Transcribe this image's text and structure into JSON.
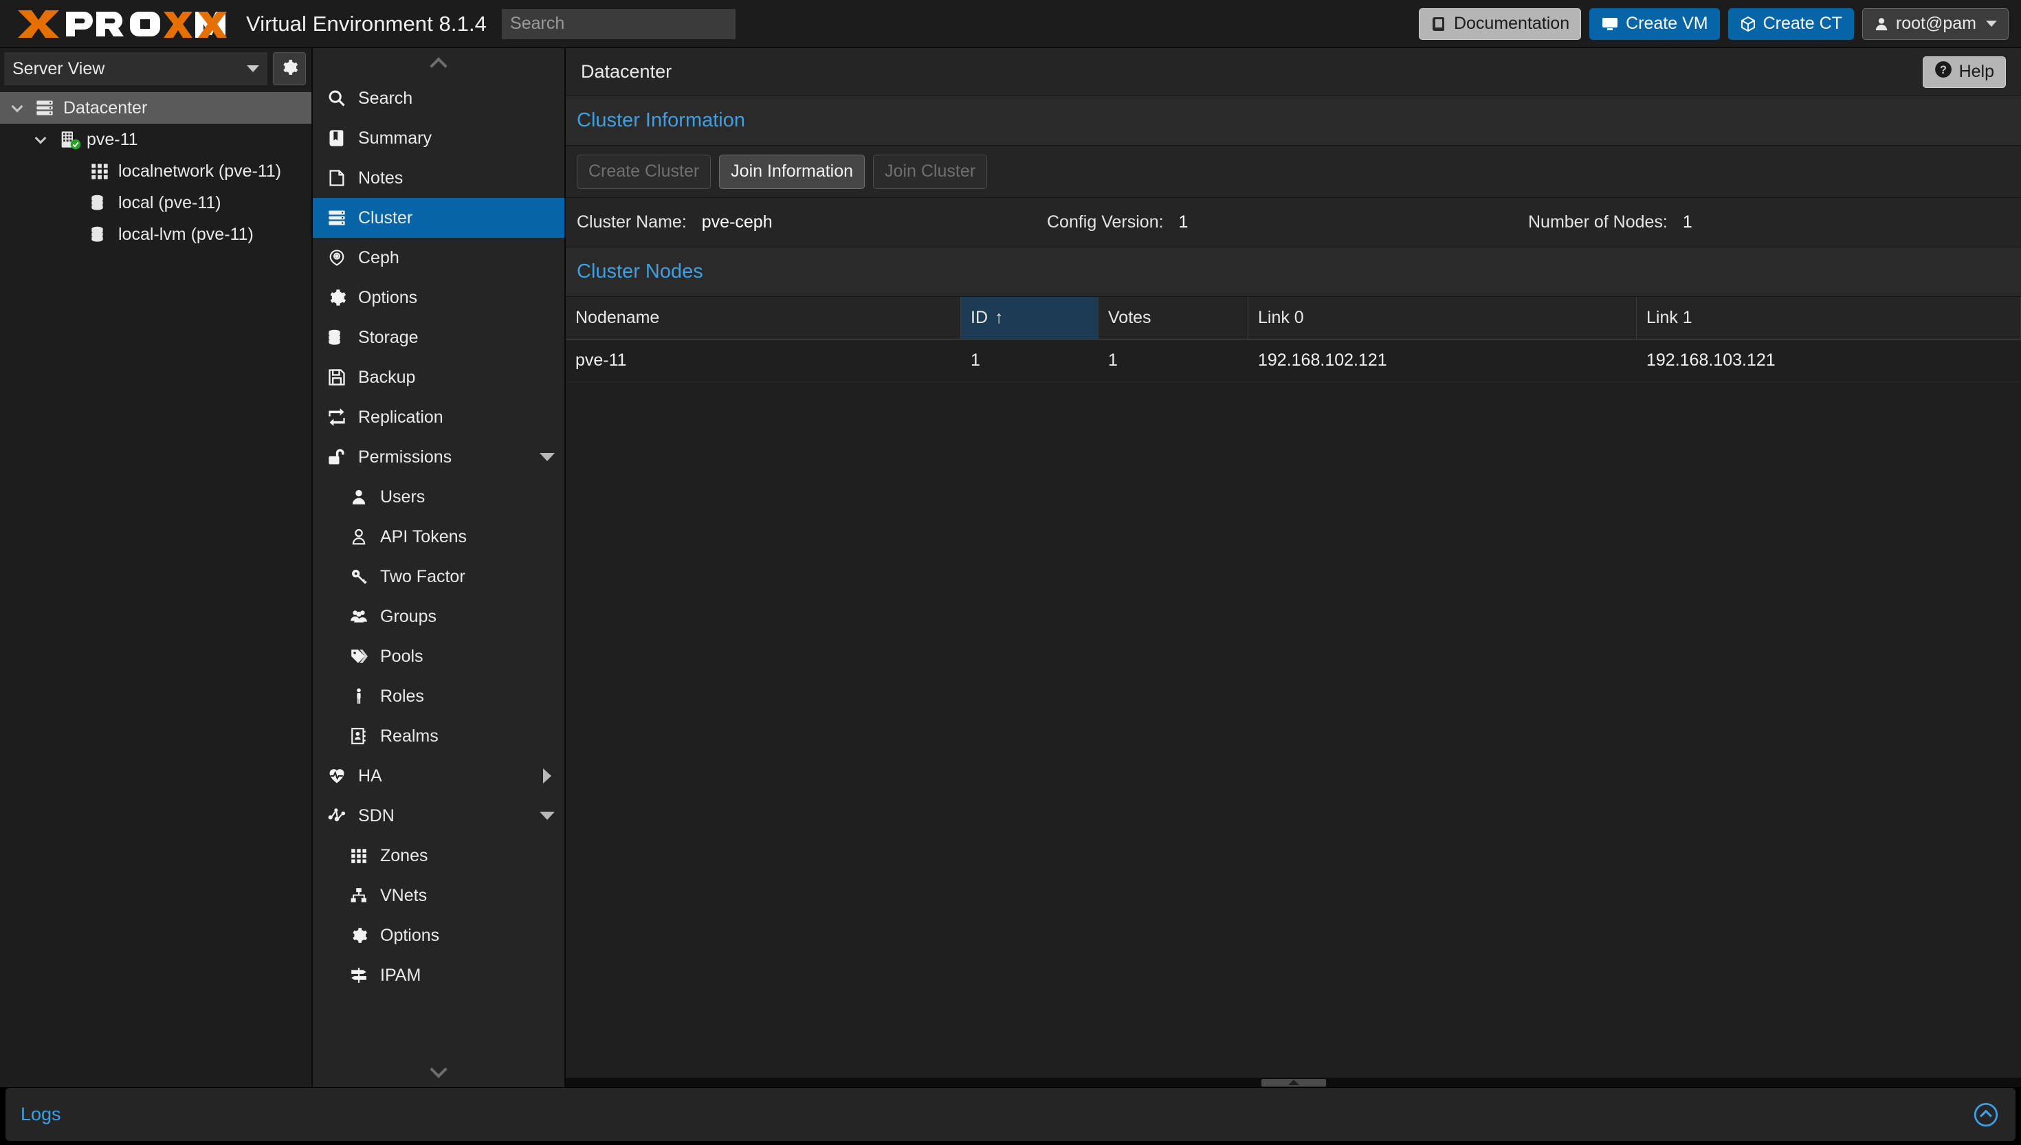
{
  "header": {
    "brand_name": "PROXMOX",
    "product_title": "Virtual Environment 8.1.4",
    "search_placeholder": "Search",
    "search_value": "",
    "buttons": [
      {
        "label": "Documentation",
        "icon": "book-icon",
        "style": "grey"
      },
      {
        "label": "Create VM",
        "icon": "monitor-icon",
        "style": "blue"
      },
      {
        "label": "Create CT",
        "icon": "cube-icon",
        "style": "blue"
      },
      {
        "label": "root@pam",
        "icon": "user-icon",
        "style": "dark"
      }
    ]
  },
  "sidebar": {
    "view_selector": {
      "label": "Server View",
      "icon": "chevron-down-icon"
    },
    "settings_button_icon": "gear-icon",
    "tree": [
      {
        "label": "Datacenter",
        "icon": "datacenter-icon",
        "level": 0,
        "selected": true,
        "expanded": true
      },
      {
        "label": "pve-11",
        "icon": "node-icon",
        "level": 1,
        "selected": false,
        "expanded": true,
        "status": "online"
      },
      {
        "label": "localnetwork (pve-11)",
        "icon": "grid-icon",
        "level": 2,
        "selected": false
      },
      {
        "label": "local (pve-11)",
        "icon": "storage-icon",
        "level": 2,
        "selected": false
      },
      {
        "label": "local-lvm (pve-11)",
        "icon": "storage-icon",
        "level": 2,
        "selected": false
      }
    ]
  },
  "nav": {
    "scroll_up_icon": "chevron-up-icon",
    "scroll_down_icon": "chevron-down-icon",
    "items": [
      {
        "label": "Search",
        "icon": "search-icon",
        "depth": 0,
        "active": false
      },
      {
        "label": "Summary",
        "icon": "book-icon",
        "depth": 0,
        "active": false
      },
      {
        "label": "Notes",
        "icon": "note-icon",
        "depth": 0,
        "active": false
      },
      {
        "label": "Cluster",
        "icon": "cluster-icon",
        "depth": 0,
        "active": true
      },
      {
        "label": "Ceph",
        "icon": "ceph-icon",
        "depth": 0,
        "active": false
      },
      {
        "label": "Options",
        "icon": "gear-icon",
        "depth": 0,
        "active": false
      },
      {
        "label": "Storage",
        "icon": "storage-icon",
        "depth": 0,
        "active": false
      },
      {
        "label": "Backup",
        "icon": "floppy-icon",
        "depth": 0,
        "active": false
      },
      {
        "label": "Replication",
        "icon": "replication-icon",
        "depth": 0,
        "active": false
      },
      {
        "label": "Permissions",
        "icon": "unlock-icon",
        "depth": 0,
        "active": false,
        "expander": "down"
      },
      {
        "label": "Users",
        "icon": "user-icon",
        "depth": 1,
        "active": false
      },
      {
        "label": "API Tokens",
        "icon": "user-outline-icon",
        "depth": 1,
        "active": false
      },
      {
        "label": "Two Factor",
        "icon": "key-icon",
        "depth": 1,
        "active": false
      },
      {
        "label": "Groups",
        "icon": "groups-icon",
        "depth": 1,
        "active": false
      },
      {
        "label": "Pools",
        "icon": "tags-icon",
        "depth": 1,
        "active": false
      },
      {
        "label": "Roles",
        "icon": "person-icon",
        "depth": 1,
        "active": false
      },
      {
        "label": "Realms",
        "icon": "address-book-icon",
        "depth": 1,
        "active": false
      },
      {
        "label": "HA",
        "icon": "heartbeat-icon",
        "depth": 0,
        "active": false,
        "expander": "right"
      },
      {
        "label": "SDN",
        "icon": "sdn-icon",
        "depth": 0,
        "active": false,
        "expander": "down"
      },
      {
        "label": "Zones",
        "icon": "grid-icon",
        "depth": 1,
        "active": false
      },
      {
        "label": "VNets",
        "icon": "sitemap-icon",
        "depth": 1,
        "active": false
      },
      {
        "label": "Options",
        "icon": "gear-icon",
        "depth": 1,
        "active": false
      },
      {
        "label": "IPAM",
        "icon": "signpost-icon",
        "depth": 1,
        "active": false
      }
    ]
  },
  "content": {
    "breadcrumb": "Datacenter",
    "help_button": {
      "label": "Help",
      "icon": "question-icon"
    },
    "cluster_information": {
      "title": "Cluster Information",
      "toolbar": [
        {
          "label": "Create Cluster",
          "enabled": false
        },
        {
          "label": "Join Information",
          "enabled": true
        },
        {
          "label": "Join Cluster",
          "enabled": false
        }
      ],
      "info": [
        {
          "label": "Cluster Name:",
          "value": "pve-ceph"
        },
        {
          "label": "Config Version:",
          "value": "1"
        },
        {
          "label": "Number of Nodes:",
          "value": "1"
        }
      ]
    },
    "cluster_nodes": {
      "title": "Cluster Nodes",
      "columns": [
        {
          "label": "Nodename",
          "sorted": false
        },
        {
          "label": "ID",
          "sorted": true,
          "sort_dir": "↑"
        },
        {
          "label": "Votes",
          "sorted": false
        },
        {
          "label": "Link 0",
          "sorted": false
        },
        {
          "label": "Link 1",
          "sorted": false
        }
      ],
      "rows": [
        {
          "nodename": "pve-11",
          "id": "1",
          "votes": "1",
          "link0": "192.168.102.121",
          "link1": "192.168.103.121"
        }
      ]
    }
  },
  "footer": {
    "logs_label": "Logs",
    "collapse_icon": "chevron-up-circle-icon"
  },
  "colors": {
    "accent_blue": "#0565a6",
    "link_blue": "#3ba0e6",
    "brand_orange": "#e57000",
    "status_green": "#24a424",
    "sorted_header": "#1b3c52"
  }
}
